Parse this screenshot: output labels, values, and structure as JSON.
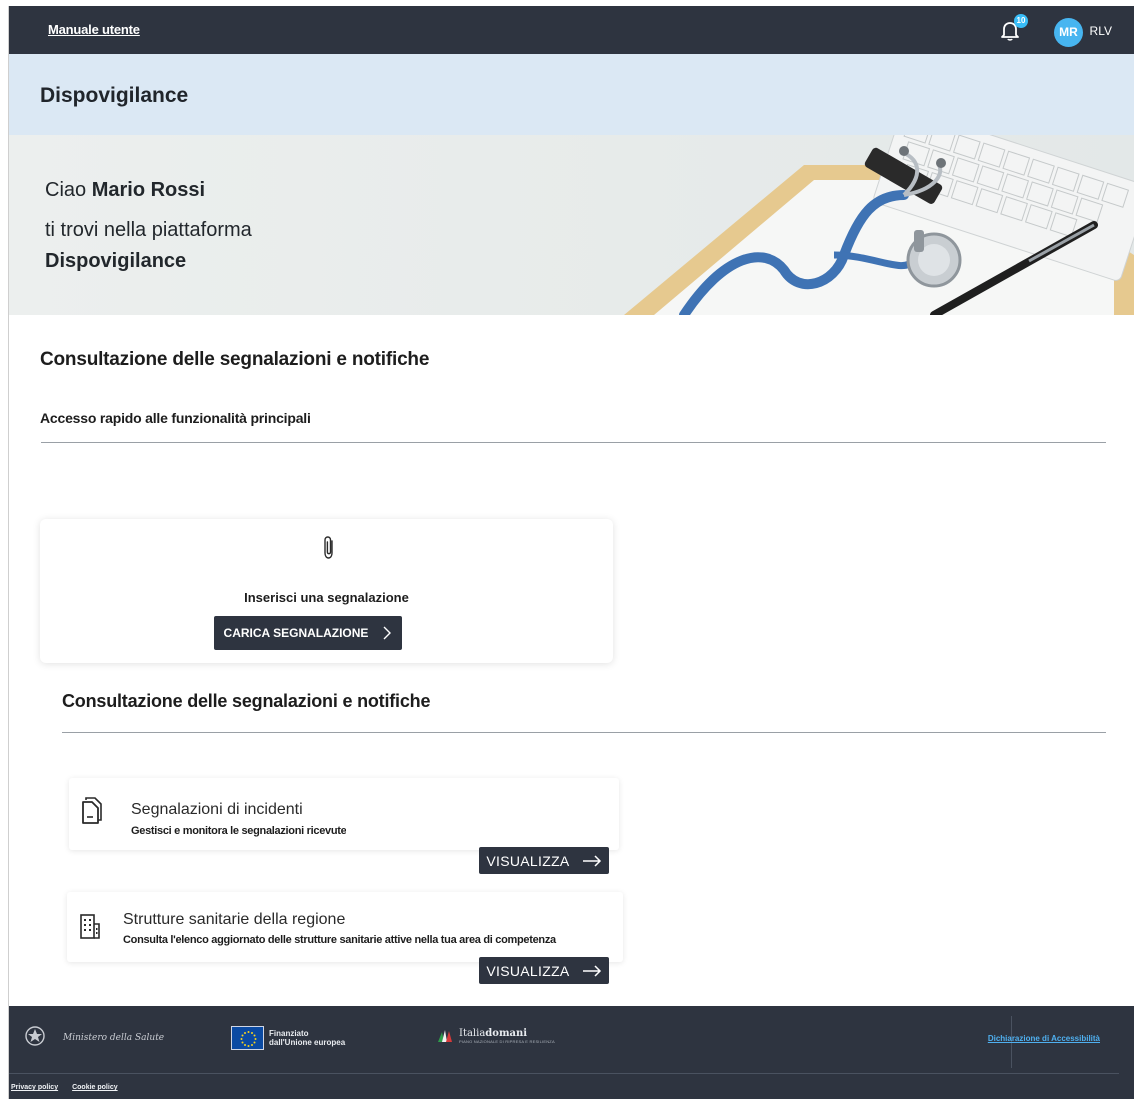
{
  "topbar": {
    "manual_link": "Manuale utente",
    "notification_count": "10",
    "avatar_initials": "MR",
    "role": "RLV"
  },
  "header": {
    "app_title": "Dispovigilance"
  },
  "hero": {
    "greeting": "Ciao",
    "user_name": "Mario Rossi",
    "line2": "ti trovi nella piattaforma",
    "platform_name": "Dispovigilance"
  },
  "main": {
    "heading": "Consultazione delle segnalazioni e notifiche",
    "subheading": "Accesso rapido alle funzionalità principali",
    "upload_card": {
      "label": "Inserisci una segnalazione",
      "button": "CARICA SEGNALAZIONE"
    },
    "second_heading": "Consultazione delle segnalazioni e notifiche",
    "items": [
      {
        "title": "Segnalazioni di incidenti",
        "description": "Gestisci e monitora le segnalazioni ricevute",
        "button": "VISUALIZZA"
      },
      {
        "title": "Strutture sanitarie della regione",
        "description": "Consulta l'elenco aggiornato delle strutture sanitarie attive nella tua area di competenza",
        "button": "VISUALIZZA"
      }
    ]
  },
  "footer": {
    "ministry": "Ministero della Salute",
    "eu_line1": "Finanziato",
    "eu_line2": "dall'Unione europea",
    "italiadomani_a": "Italia",
    "italiadomani_b": "domani",
    "italiadomani_tag": "PIANO NAZIONALE DI RIPRESA E RESILIENZA",
    "accessibility": "Dichiarazione di Accessibilità",
    "privacy": "Privacy policy",
    "cookie": "Cookie policy"
  },
  "colors": {
    "dark": "#2e3440",
    "header_band": "#dbe8f4",
    "accent": "#47b5f0"
  }
}
